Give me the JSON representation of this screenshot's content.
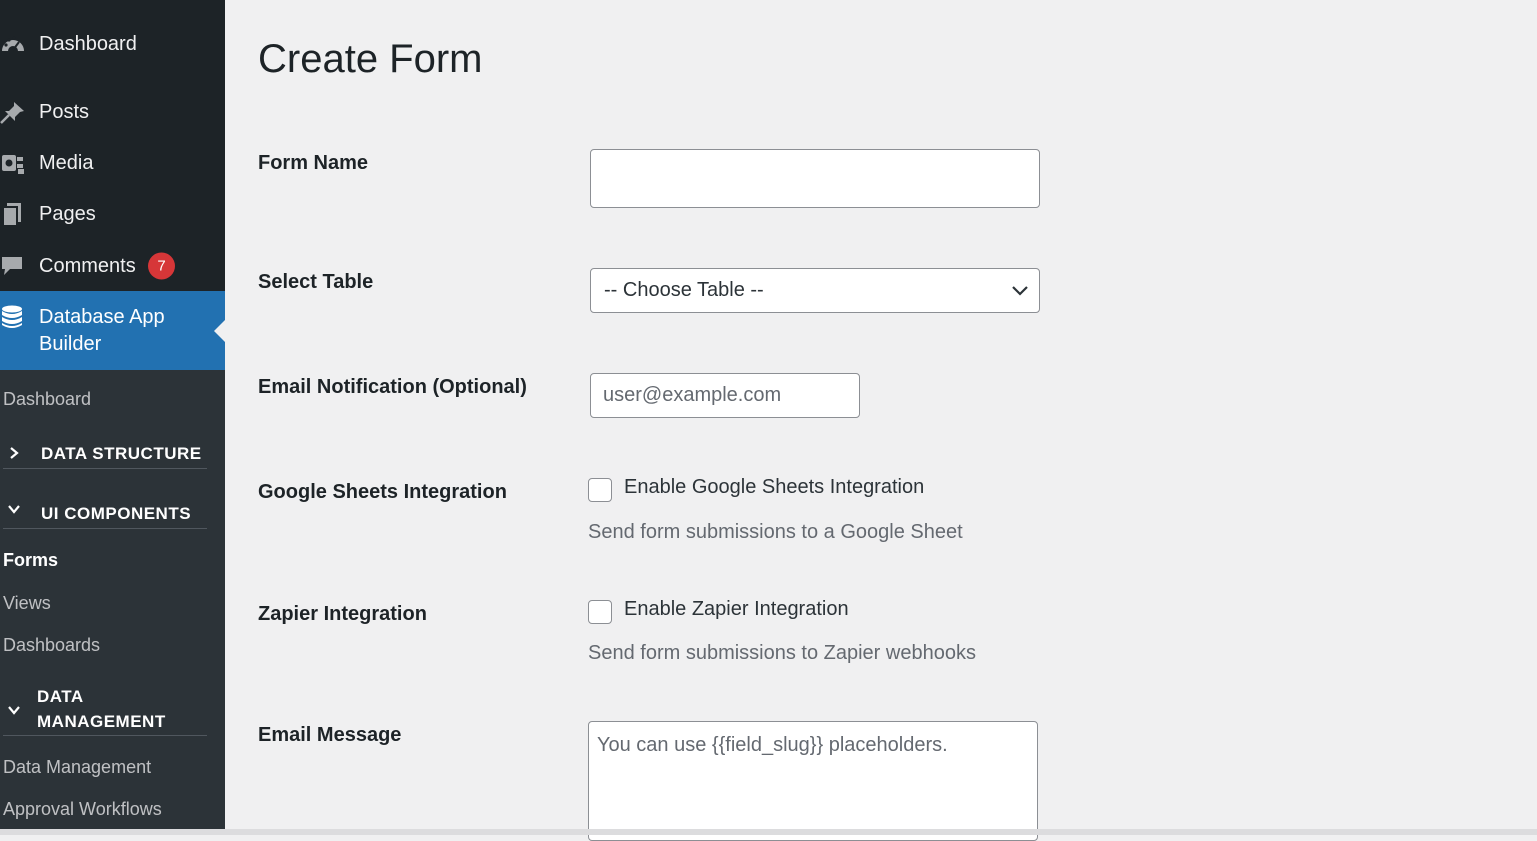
{
  "sidebar": {
    "menu": {
      "dashboard": "Dashboard",
      "posts": "Posts",
      "media": "Media",
      "pages": "Pages",
      "comments": "Comments",
      "comments_count": "7",
      "dab_line1": "Database App",
      "dab_line2": "Builder"
    },
    "submenu": {
      "dashboard": "Dashboard",
      "data_structure": "DATA STRUCTURE",
      "ui_components": "UI COMPONENTS",
      "forms": "Forms",
      "views": "Views",
      "dashboards": "Dashboards",
      "data_management_line1": "DATA",
      "data_management_line2": "MANAGEMENT",
      "data_management_link": "Data Management",
      "approval_workflows": "Approval Workflows"
    }
  },
  "page": {
    "title": "Create Form"
  },
  "form": {
    "form_name": {
      "label": "Form Name",
      "value": ""
    },
    "select_table": {
      "label": "Select Table",
      "selected": "-- Choose Table --"
    },
    "email_notification": {
      "label": "Email Notification (Optional)",
      "placeholder": "user@example.com"
    },
    "google_sheets": {
      "label": "Google Sheets Integration",
      "checkbox_label": "Enable Google Sheets Integration",
      "checked": false,
      "description": "Send form submissions to a Google Sheet"
    },
    "zapier": {
      "label": "Zapier Integration",
      "checkbox_label": "Enable Zapier Integration",
      "checked": false,
      "description": "Send form submissions to Zapier webhooks"
    },
    "email_message": {
      "label": "Email Message",
      "placeholder": "You can use {{field_slug}} placeholders."
    }
  },
  "colors": {
    "sidebar_bg": "#1d2327",
    "submenu_bg": "#2c3338",
    "accent": "#2271b1",
    "badge": "#d63638",
    "page_bg": "#f0f0f1"
  },
  "icons": {
    "dashboard": "dashboard-gauge-icon",
    "posts": "pushpin-icon",
    "media": "media-camera-icon",
    "pages": "pages-icon",
    "comments": "speech-bubble-icon",
    "database": "database-icon",
    "collapsed": "chevron-right-icon",
    "expanded": "chevron-down-icon",
    "select": "chevron-down-icon"
  }
}
